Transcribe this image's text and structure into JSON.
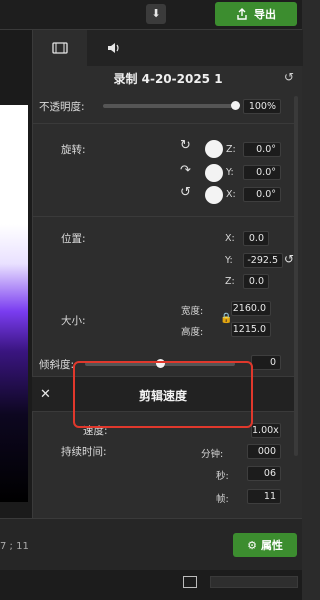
{
  "toolbar": {
    "download_icon": "download-arrow",
    "export_label": "导出"
  },
  "tabs": [
    {
      "name": "media-properties",
      "icon": "film-icon",
      "active": true
    },
    {
      "name": "audio-properties",
      "icon": "speaker-icon",
      "active": false
    }
  ],
  "clip": {
    "title": "录制 4-20-2025 1"
  },
  "opacity": {
    "label": "不透明度:",
    "value": "100%",
    "level": 1.0
  },
  "rotation": {
    "label": "旋转:",
    "z_label": "Z:",
    "z_value": "0.0°",
    "y_label": "Y:",
    "y_value": "0.0°",
    "x_label": "X:",
    "x_value": "0.0°"
  },
  "position": {
    "label": "位置:",
    "x_label": "X:",
    "x_value": "0.0",
    "y_label": "Y:",
    "y_value": "-292.5",
    "z_label": "Z:",
    "z_value": "0.0"
  },
  "size": {
    "label": "大小:",
    "width_label": "宽度:",
    "width_value": "2160.0",
    "height_label": "高度:",
    "height_value": "1215.0"
  },
  "skew": {
    "label": "倾斜度:",
    "value": "0",
    "level": 0.5
  },
  "speed": {
    "header": "剪辑速度",
    "speed_label": "速度:",
    "speed_value": "1.00x",
    "duration_label": "持续时间:",
    "minutes_label": "分钟:",
    "minutes_value": "000",
    "seconds_label": "秒:",
    "seconds_value": "06",
    "frames_label": "帧:",
    "frames_value": "11"
  },
  "bottom": {
    "timecode_fragment": "7 ; 11",
    "properties_label": "属性"
  },
  "colors": {
    "accent_green": "#3c8d2f",
    "highlight_red": "#e0382c",
    "panel_bg": "#2d2d2d"
  }
}
